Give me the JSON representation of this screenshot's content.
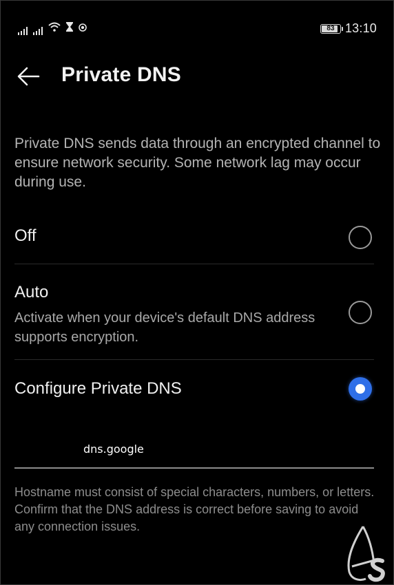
{
  "status_bar": {
    "battery": "83",
    "time": "13:10"
  },
  "header": {
    "back_icon": "arrow-back-icon",
    "title": "Private DNS"
  },
  "description": "Private DNS sends data through an encrypted channel to ensure network security. Some network lag may occur during use.",
  "options": [
    {
      "label": "Off",
      "subtitle": "",
      "selected": false
    },
    {
      "label": "Auto",
      "subtitle": "Activate when your device's default DNS address supports encryption.",
      "selected": false
    },
    {
      "label": "Configure Private DNS",
      "subtitle": "",
      "selected": true
    }
  ],
  "hostname": {
    "value": "dns.google"
  },
  "hint": "Hostname must consist of special characters, numbers, or letters. Confirm that the DNS address is correct before saving to avoid any connection issues.",
  "colors": {
    "accent": "#2f6fe8",
    "background": "#000000"
  }
}
